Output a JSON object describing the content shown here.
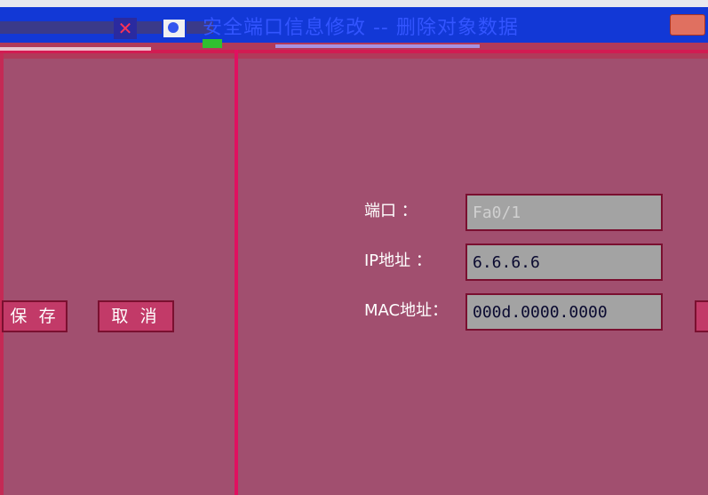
{
  "window": {
    "title": "安全端口信息修改 -- 删除对象数据"
  },
  "colors": {
    "background": "#a14f6f",
    "titlebar": "#1238d6",
    "divider": "#e01060",
    "input_bg": "#a3a3a3"
  },
  "buttons": {
    "save_label": "保 存",
    "cancel_label": "取 消"
  },
  "form": {
    "port_label": "端口   ：",
    "port_value": "Fa0/1",
    "ip_label": "IP地址  ：",
    "ip_value": "6.6.6.6",
    "mac_label": "MAC地址：",
    "mac_value": "000d.0000.0000"
  }
}
